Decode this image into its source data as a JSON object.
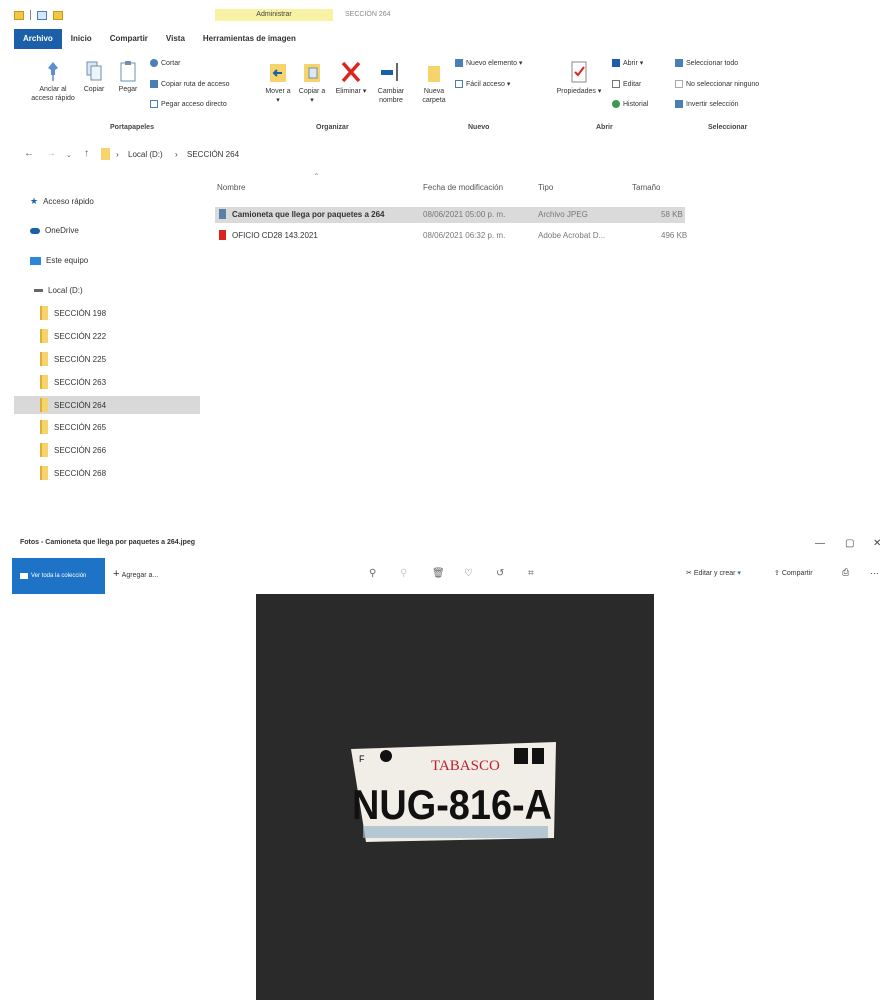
{
  "explorer": {
    "window_title": "SECCIÓN 264",
    "contextual_tab": "Administrar",
    "ribbon_tabs": [
      "Archivo",
      "Inicio",
      "Compartir",
      "Vista",
      "Herramientas de imagen"
    ],
    "ribbon": {
      "pin_label": "Anclar al acceso rápido",
      "copy_label": "Copiar",
      "paste_label": "Pegar",
      "cut_label": "Cortar",
      "copy_path_label": "Copiar ruta de acceso",
      "paste_shortcut_label": "Pegar acceso directo",
      "move_label": "Mover a ▾",
      "copyto_label": "Copiar a ▾",
      "delete_label": "Eliminar ▾",
      "rename_label": "Cambiar nombre",
      "newfolder_label": "Nueva carpeta",
      "new_item_label": "Nuevo elemento ▾",
      "easy_access_label": "Fácil acceso ▾",
      "properties_label": "Propiedades ▾",
      "open_label": "Abrir ▾",
      "edit_label": "Editar",
      "history_label": "Historial",
      "select_all_label": "Seleccionar todo",
      "select_none_label": "No seleccionar ninguno",
      "invert_label": "Invertir selección",
      "groups": [
        "Portapapeles",
        "Organizar",
        "Nuevo",
        "Abrir",
        "Seleccionar"
      ]
    },
    "breadcrumb": [
      "Local (D:)",
      "SECCIÓN 264"
    ],
    "sidebar": {
      "quick_access": "Acceso rápido",
      "onedrive": "OneDrive",
      "this_pc": "Este equipo",
      "drive": "Local (D:)",
      "folders": [
        "SECCIÓN 198",
        "SECCIÓN 222",
        "SECCIÓN 225",
        "SECCIÓN 263",
        "SECCIÓN 264",
        "SECCIÓN 265",
        "SECCIÓN 266",
        "SECCIÓN 268"
      ]
    },
    "columns": [
      "Nombre",
      "Fecha de modificación",
      "Tipo",
      "Tamaño"
    ],
    "files": [
      {
        "name": "Camioneta que llega por paquetes a 264",
        "date": "08/06/2021 05:00 p. m.",
        "type": "Archivo JPEG",
        "size": "58 KB"
      },
      {
        "name": "OFICIO CD28 143.2021",
        "date": "08/06/2021 06:32 p. m.",
        "type": "Adobe Acrobat D...",
        "size": "496 KB"
      }
    ]
  },
  "photos": {
    "title": "Fotos - Camioneta que llega por paquetes a 264.jpeg",
    "collection_label": "Ver toda la colección",
    "add_label": "Agregar a...",
    "edit_create": "Editar y crear",
    "share": "Compartir",
    "win_controls": [
      "—",
      "▢",
      "✕"
    ],
    "plate": {
      "state": "TABASCO",
      "number": "NUG-816-A",
      "letter": "F"
    }
  },
  "colors": {
    "accent": "#1b5fa8",
    "photos_accent": "#1e73c6",
    "folder": "#f6d36b",
    "photo_bg": "#2a2a2a"
  }
}
